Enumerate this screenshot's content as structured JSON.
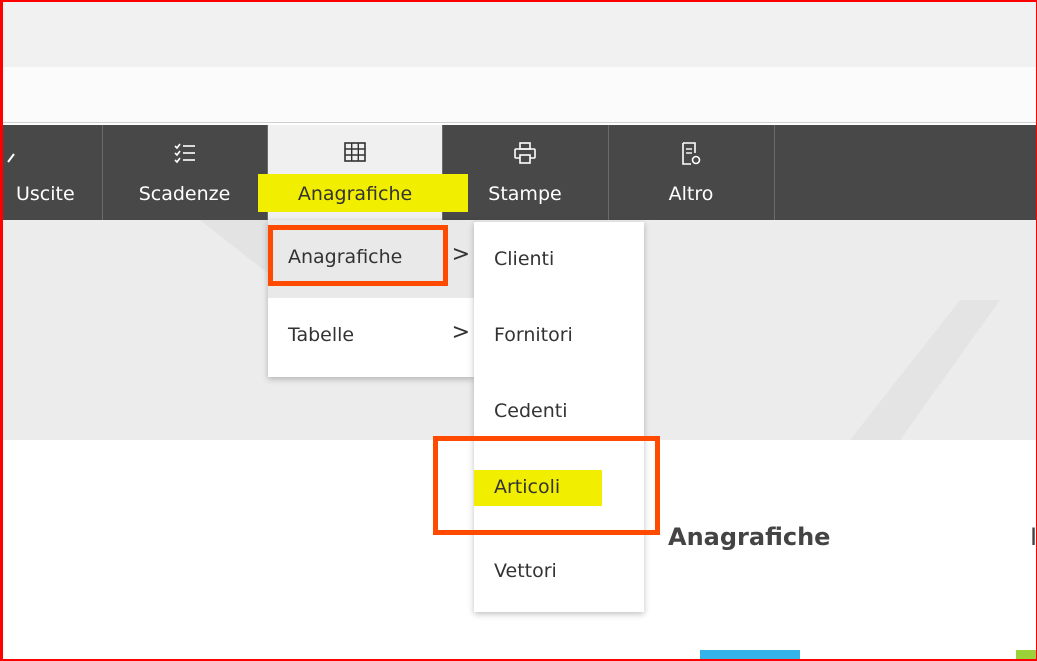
{
  "navbar": {
    "items": [
      {
        "label": "Uscite",
        "icon": "uscite-icon"
      },
      {
        "label": "Scadenze",
        "icon": "checklist-icon"
      },
      {
        "label": "Anagrafiche",
        "icon": "grid-table-icon"
      },
      {
        "label": "Stampe",
        "icon": "printer-icon"
      },
      {
        "label": "Altro",
        "icon": "document-gear-icon"
      }
    ],
    "active": "Anagrafiche"
  },
  "submenu_level1": {
    "items": [
      {
        "label": "Anagrafiche",
        "has_submenu": true
      },
      {
        "label": "Tabelle",
        "has_submenu": true
      }
    ],
    "chevron": ">"
  },
  "submenu_level2": {
    "items": [
      {
        "label": "Clienti"
      },
      {
        "label": "Fornitori"
      },
      {
        "label": "Cedenti"
      },
      {
        "label": "Articoli"
      },
      {
        "label": "Vettori"
      }
    ]
  },
  "page": {
    "section_title": "Anagrafiche",
    "partial_char": "I"
  },
  "colors": {
    "navbar_bg": "#484848",
    "highlight_yellow": "#f2ee00",
    "annotation_orange": "#ff4a00",
    "frame_red": "#ff0000",
    "logo_blue": "#35b4ea",
    "logo_green": "#9bd23a"
  }
}
